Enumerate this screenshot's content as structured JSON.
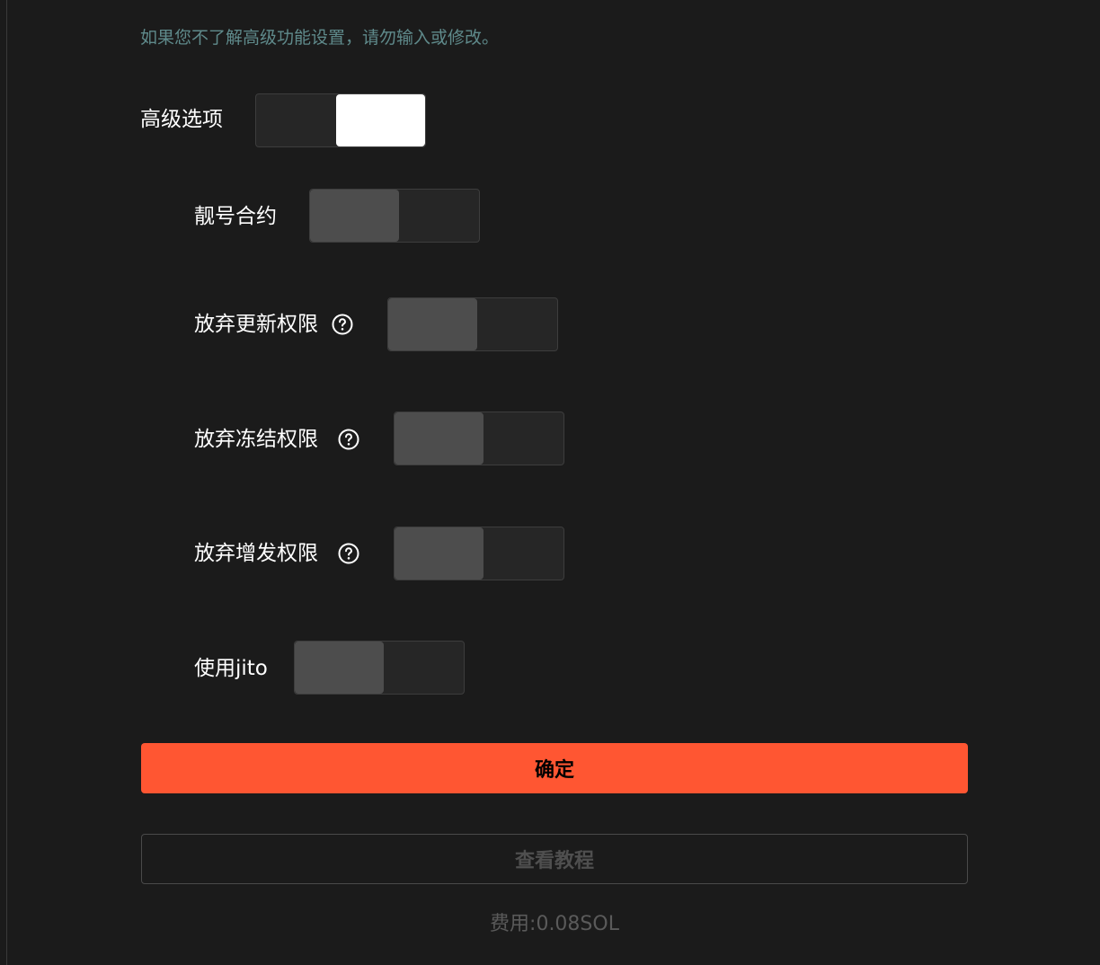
{
  "hint_text": "如果您不了解高级功能设置，请勿输入或修改。",
  "options": [
    {
      "label": "高级选项",
      "enabled": true,
      "has_help": false
    },
    {
      "label": "靓号合约",
      "enabled": false,
      "has_help": false
    },
    {
      "label": "放弃更新权限",
      "enabled": false,
      "has_help": true
    },
    {
      "label": "放弃冻结权限",
      "enabled": false,
      "has_help": true
    },
    {
      "label": "放弃增发权限",
      "enabled": false,
      "has_help": true
    },
    {
      "label": "使用jito",
      "enabled": false,
      "has_help": false
    }
  ],
  "buttons": {
    "confirm_label": "确定",
    "tutorial_label": "查看教程"
  },
  "fee_text": "费用:0.08SOL",
  "icons": {
    "help": "question-circle-icon"
  },
  "colors": {
    "background": "#1b1b1b",
    "accent": "#ff5632",
    "hint": "#5f8a8b",
    "toggle_on_knob": "#ffffff",
    "toggle_off_knob": "#4d4d4d"
  }
}
